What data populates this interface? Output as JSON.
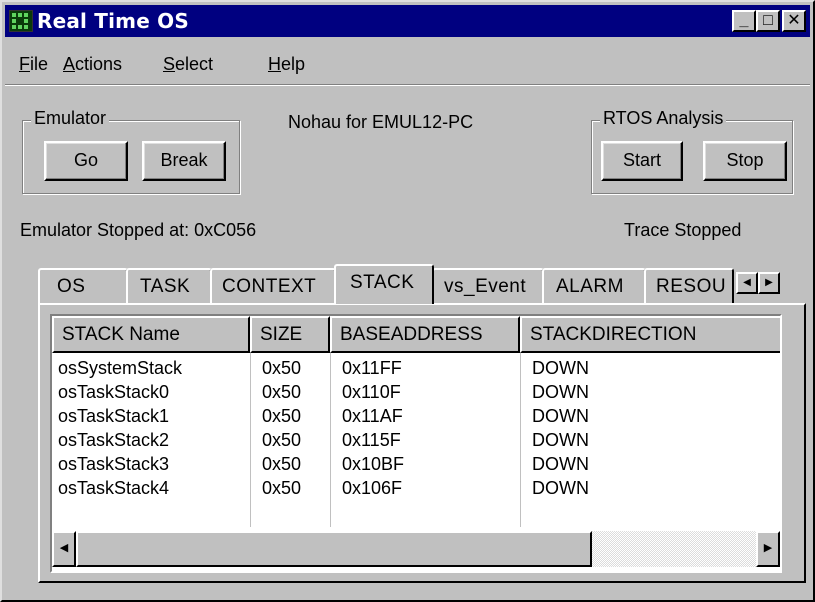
{
  "window": {
    "title": "Real Time OS",
    "controls": {
      "minimize": "_",
      "maximize": "□",
      "close": "✕"
    }
  },
  "menu": [
    {
      "mnemonic": "F",
      "rest": "ile"
    },
    {
      "mnemonic": "A",
      "rest": "ctions"
    },
    {
      "mnemonic": "S",
      "rest": "elect"
    },
    {
      "mnemonic": "H",
      "rest": "elp"
    }
  ],
  "emulator": {
    "label": "Emulator",
    "go": "Go",
    "break": "Break"
  },
  "target_text": "Nohau for EMUL12-PC",
  "rtos": {
    "label": "RTOS  Analysis",
    "start": "Start",
    "stop": "Stop"
  },
  "status": {
    "emulator": "Emulator Stopped at: 0xC056",
    "trace": "Trace Stopped"
  },
  "tabs": [
    "OS",
    "TASK",
    "CONTEXT",
    "STACK",
    "vs_Event",
    "ALARM",
    "RESOU"
  ],
  "active_tab": "STACK",
  "tab_scroll": {
    "left": "◀",
    "right": "▶"
  },
  "table": {
    "columns": [
      "STACK Name",
      "SIZE",
      "BASEADDRESS",
      "STACKDIRECTION"
    ],
    "rows": [
      [
        "osSystemStack",
        "0x50",
        "0x11FF",
        "DOWN"
      ],
      [
        "osTaskStack0",
        "0x50",
        "0x110F",
        "DOWN"
      ],
      [
        "osTaskStack1",
        "0x50",
        "0x11AF",
        "DOWN"
      ],
      [
        "osTaskStack2",
        "0x50",
        "0x115F",
        "DOWN"
      ],
      [
        "osTaskStack3",
        "0x50",
        "0x10BF",
        "DOWN"
      ],
      [
        "osTaskStack4",
        "0x50",
        "0x106F",
        "DOWN"
      ]
    ]
  },
  "hscroll": {
    "left": "◀",
    "right": "▶"
  },
  "colors": {
    "titlebar": "#000080",
    "face": "#c0c0c0",
    "list_bg": "#ffffff"
  }
}
